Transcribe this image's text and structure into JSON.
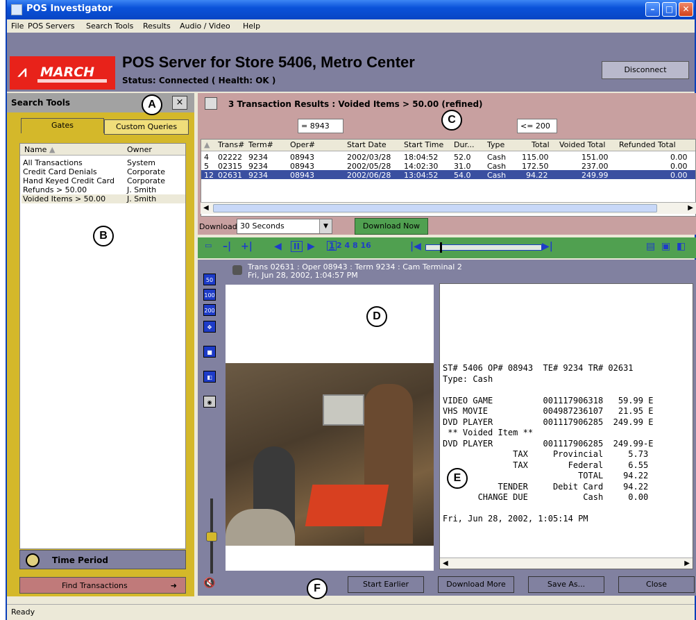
{
  "window": {
    "title": "POS Investigator"
  },
  "menu": [
    "File",
    "POS Servers",
    "Search Tools",
    "Results",
    "Audio / Video",
    "Help"
  ],
  "header": {
    "logo": "MARCH",
    "server_title": "POS Server for Store 5406, Metro Center",
    "status": "Status: Connected ( Health: OK )",
    "disconnect": "Disconnect"
  },
  "search_tools": {
    "title": "Search Tools",
    "close": "×",
    "tabs": [
      "Gates",
      "Custom Queries"
    ],
    "columns": [
      "Name",
      "Owner"
    ],
    "gates": [
      {
        "name": "All Transactions",
        "owner": "System"
      },
      {
        "name": "Credit Card Denials",
        "owner": "Corporate"
      },
      {
        "name": "Hand Keyed Credit Card",
        "owner": "Corporate"
      },
      {
        "name": "Refunds > 50.00",
        "owner": "J. Smith"
      },
      {
        "name": "Voided Items > 50.00",
        "owner": "J. Smith"
      }
    ],
    "time_period": "Time Period",
    "find": "Find Transactions"
  },
  "results": {
    "title": "3 Transaction Results : Voided Items > 50.00 (refined)",
    "filter_oper": "= 8943",
    "filter_dur": "<= 200",
    "columns": [
      "Trans#",
      "Term#",
      "Oper#",
      "Start Date",
      "Start Time",
      "Dur...",
      "Type",
      "Total",
      "Voided Total",
      "Refunded Total"
    ],
    "rows": [
      {
        "n": "4",
        "trans": "02222",
        "term": "9234",
        "oper": "08943",
        "date": "2002/03/28",
        "time": "18:04:52",
        "dur": "52.0",
        "type": "Cash",
        "total": "115.00",
        "voided": "151.00",
        "refunded": "0.00"
      },
      {
        "n": "5",
        "trans": "02315",
        "term": "9234",
        "oper": "08943",
        "date": "2002/05/28",
        "time": "14:02:30",
        "dur": "31.0",
        "type": "Cash",
        "total": "172.50",
        "voided": "237.00",
        "refunded": "0.00"
      },
      {
        "n": "12",
        "trans": "02631",
        "term": "9234",
        "oper": "08943",
        "date": "2002/06/28",
        "time": "13:04:52",
        "dur": "54.0",
        "type": "Cash",
        "total": "94.22",
        "voided": "249.99",
        "refunded": "0.00"
      }
    ],
    "download_label": "Download:",
    "download_value": "30 Seconds",
    "download_now": "Download Now"
  },
  "player": {
    "speeds": "2 4 8 16",
    "step": "1"
  },
  "camera": {
    "line1": "Trans 02631 : Oper 08943 : Term 9234 : Cam Terminal 2",
    "line2": "Fri, Jun 28, 2002, 1:04:57 PM",
    "zoom": [
      "50",
      "100",
      "200"
    ]
  },
  "receipt": {
    "text": "ST# 5406 OP# 08943  TE# 9234 TR# 02631\nType: Cash\n\nVIDEO GAME          001117906318   59.99 E\nVHS MOVIE           004987236107   21.95 E\nDVD PLAYER          001117906285  249.99 E\n ** Voided Item **\nDVD PLAYER          001117906285  249.99-E\n              TAX     Provincial     5.73\n              TAX        Federal     6.55\n                           TOTAL    94.22\n           TENDER     Debit Card    94.22\n       CHANGE DUE           Cash     0.00\n\nFri, Jun 28, 2002, 1:05:14 PM"
  },
  "bottom": {
    "start_earlier": "Start Earlier",
    "download_more": "Download More",
    "save_as": "Save As...",
    "close": "Close"
  },
  "callouts": [
    "A",
    "B",
    "C",
    "D",
    "E",
    "F"
  ],
  "status_bar": "Ready"
}
